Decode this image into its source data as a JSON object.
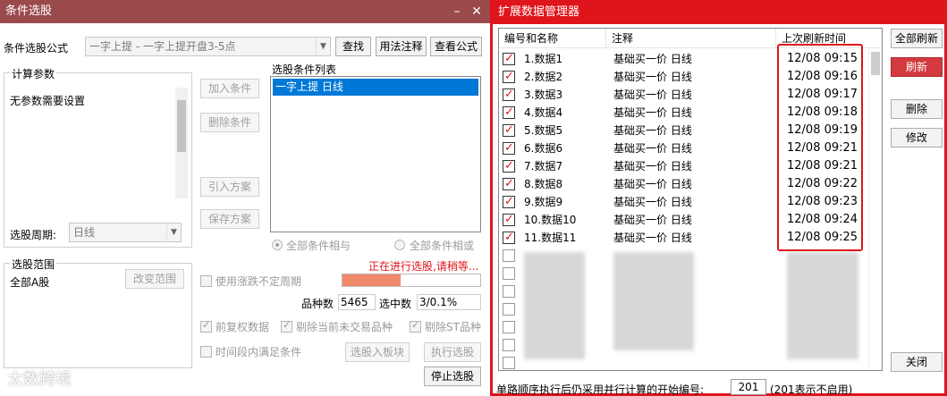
{
  "left_window": {
    "title": "条件选股",
    "minimize": "–",
    "close": "✕",
    "formula_label": "条件选股公式",
    "formula_value": "一字上提  -  一字上提开盘3-5点",
    "btn_find": "查找",
    "btn_usage": "用法注释",
    "btn_view": "查看公式",
    "params_group": "计算参数",
    "params_text": "无参数需要设置",
    "btn_add": "加入条件",
    "btn_delete": "删除条件",
    "btn_import": "引入方案",
    "btn_save": "保存方案",
    "cond_list_label": "选股条件列表",
    "cond_items": [
      "一字上提  日线"
    ],
    "period_label": "选股周期:",
    "period_value": "日线",
    "radio_and": "全部条件相与",
    "radio_or": "全部条件相或",
    "status": "正在进行选股,请稍等...",
    "range_group": "选股范围",
    "range_value": "全部A股",
    "btn_change_range": "改变范围",
    "chk_uncertain": "使用涨跌不定周期",
    "count_label": "品种数",
    "count_value": "5465",
    "selected_label": "选中数",
    "selected_value": "3/0.1%",
    "progress": 0.42,
    "chk_fq": "前复权数据",
    "chk_notrade": "剔除当前未交易品种",
    "chk_st": "剔除ST品种",
    "chk_time": "时间段内满足条件",
    "btn_to_block": "选股入板块",
    "btn_exec": "执行选股",
    "btn_stop": "停止选股"
  },
  "right_window": {
    "title": "扩展数据管理器",
    "col_name": "编号和名称",
    "col_note": "注释",
    "col_time": "上次刷新时间",
    "rows": [
      {
        "name": "1.数据1",
        "note": "基础买一价 日线",
        "time": "12/08 09:15"
      },
      {
        "name": "2.数据2",
        "note": "基础买一价 日线",
        "time": "12/08 09:16"
      },
      {
        "name": "3.数据3",
        "note": "基础买一价 日线",
        "time": "12/08 09:17"
      },
      {
        "name": "4.数据4",
        "note": "基础买一价 日线",
        "time": "12/08 09:18"
      },
      {
        "name": "5.数据5",
        "note": "基础买一价 日线",
        "time": "12/08 09:19"
      },
      {
        "name": "6.数据6",
        "note": "基础买一价 日线",
        "time": "12/08 09:21"
      },
      {
        "name": "7.数据7",
        "note": "基础买一价 日线",
        "time": "12/08 09:21"
      },
      {
        "name": "8.数据8",
        "note": "基础买一价 日线",
        "time": "12/08 09:22"
      },
      {
        "name": "9.数据9",
        "note": "基础买一价 日线",
        "time": "12/08 09:23"
      },
      {
        "name": "10.数据10",
        "note": "基础买一价 日线",
        "time": "12/08 09:24"
      },
      {
        "name": "11.数据11",
        "note": "基础买一价 日线",
        "time": "12/08 09:25"
      }
    ],
    "btn_refresh_all": "全部刷新",
    "btn_refresh": "刷新",
    "btn_delete": "删除",
    "btn_modify": "修改",
    "btn_close": "关闭",
    "bottom_label": "单路顺序执行后仍采用并行计算的开始编号:",
    "bottom_value": "201",
    "bottom_note": "(201表示不启用)"
  },
  "watermark": "太数跨境",
  "colors": {
    "title_left": "#9b4a4c",
    "accent_red": "#e0141b",
    "selection": "#0078d7",
    "progress": "#f08a6a"
  }
}
